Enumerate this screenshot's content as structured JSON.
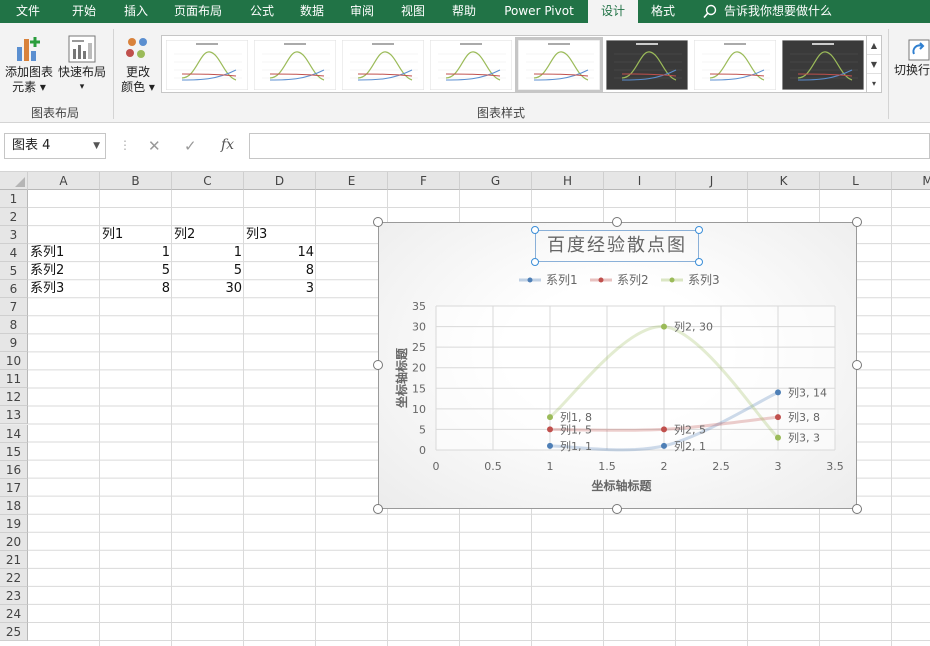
{
  "ribbon_tabs": [
    {
      "label": "文件",
      "active": false
    },
    {
      "label": "开始",
      "active": false
    },
    {
      "label": "插入",
      "active": false
    },
    {
      "label": "页面布局",
      "active": false
    },
    {
      "label": "公式",
      "active": false
    },
    {
      "label": "数据",
      "active": false
    },
    {
      "label": "审阅",
      "active": false
    },
    {
      "label": "视图",
      "active": false
    },
    {
      "label": "帮助",
      "active": false
    },
    {
      "label": "Power Pivot",
      "active": false
    },
    {
      "label": "设计",
      "active": true
    },
    {
      "label": "格式",
      "active": false
    }
  ],
  "tell_me": "告诉我你想要做什么",
  "ribbon": {
    "add_element_line1": "添加图表",
    "add_element_line2": "元素",
    "quick_layout": "快速布局",
    "change_colors_line1": "更改",
    "change_colors_line2": "颜色",
    "group_layout": "图表布局",
    "group_styles": "图表样式",
    "switch_row_col": "切换行",
    "selected_style_index": 5
  },
  "formula_bar": {
    "name_box": "图表 4",
    "cancel": "✕",
    "enter": "✓",
    "fx": "fx",
    "formula": ""
  },
  "columns": [
    "A",
    "B",
    "C",
    "D",
    "E",
    "F",
    "G",
    "H",
    "I",
    "J",
    "K",
    "L",
    "M"
  ],
  "rows": [
    "1",
    "2",
    "3",
    "4",
    "5",
    "6",
    "7",
    "8",
    "9",
    "10",
    "11",
    "12",
    "13",
    "14",
    "15",
    "16",
    "17",
    "18",
    "19",
    "20",
    "21",
    "22",
    "23",
    "24",
    "25"
  ],
  "sheet_cells": {
    "B3": "列1",
    "C3": "列2",
    "D3": "列3",
    "A4": "系列1",
    "B4": "1",
    "C4": "1",
    "D4": "14",
    "A5": "系列2",
    "B5": "5",
    "C5": "5",
    "D5": "8",
    "A6": "系列3",
    "B6": "8",
    "C6": "30",
    "D6": "3"
  },
  "chart_data": {
    "type": "scatter",
    "title": "百度经验散点图",
    "xlabel": "坐标轴标题",
    "ylabel": "坐标轴标题",
    "xlim": [
      0,
      3.5
    ],
    "ylim": [
      0,
      35
    ],
    "x_ticks": [
      "0",
      "0.5",
      "1",
      "1.5",
      "2",
      "2.5",
      "3",
      "3.5"
    ],
    "y_ticks": [
      "0",
      "5",
      "10",
      "15",
      "20",
      "25",
      "30",
      "35"
    ],
    "grid": true,
    "legend_position": "top",
    "smooth_lines": true,
    "series": [
      {
        "name": "系列1",
        "color": "#4e7fb6",
        "x": [
          1,
          2,
          3
        ],
        "y": [
          1,
          1,
          14
        ],
        "labels": [
          "列1, 1",
          "列2, 1",
          "列3, 14"
        ]
      },
      {
        "name": "系列2",
        "color": "#c0504d",
        "x": [
          1,
          2,
          3
        ],
        "y": [
          5,
          5,
          8
        ],
        "labels": [
          "列1, 5",
          "列2, 5",
          "列3, 8"
        ]
      },
      {
        "name": "系列3",
        "color": "#9bbb59",
        "x": [
          1,
          2,
          3
        ],
        "y": [
          8,
          30,
          3
        ],
        "labels": [
          "列1, 8",
          "列2, 30",
          "列3, 3"
        ]
      }
    ]
  }
}
